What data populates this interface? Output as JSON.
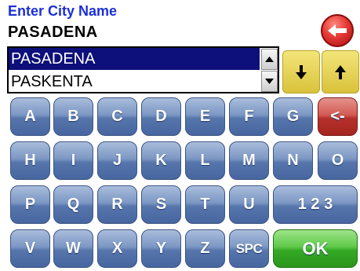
{
  "header": {
    "prompt": "Enter City Name",
    "entry_value": "PASADENA"
  },
  "icons": {
    "back": "back-arrow-icon",
    "scroll_up": "scroll-up-icon",
    "scroll_down": "scroll-down-icon",
    "arrow_down": "arrow-down-icon",
    "arrow_up": "arrow-up-icon"
  },
  "list": {
    "items": [
      "PASADENA",
      "PASKENTA"
    ],
    "selected_index": 0
  },
  "keyboard": {
    "row1": [
      "A",
      "B",
      "C",
      "D",
      "E",
      "F",
      "G",
      "<-"
    ],
    "row2": [
      "H",
      "I",
      "J",
      "K",
      "L",
      "M",
      "N",
      "O"
    ],
    "row3": [
      "P",
      "Q",
      "R",
      "S",
      "T",
      "U",
      "1 2 3"
    ],
    "row4": [
      "V",
      "W",
      "X",
      "Y",
      "Z",
      "SPC",
      "OK"
    ]
  },
  "colors": {
    "prompt": "#1c2fd8",
    "selection": "#0d0f7a",
    "key_blue": "#5675ab",
    "key_red": "#b5302a",
    "key_green": "#34a825",
    "arrow_yellow": "#d9c23a"
  }
}
